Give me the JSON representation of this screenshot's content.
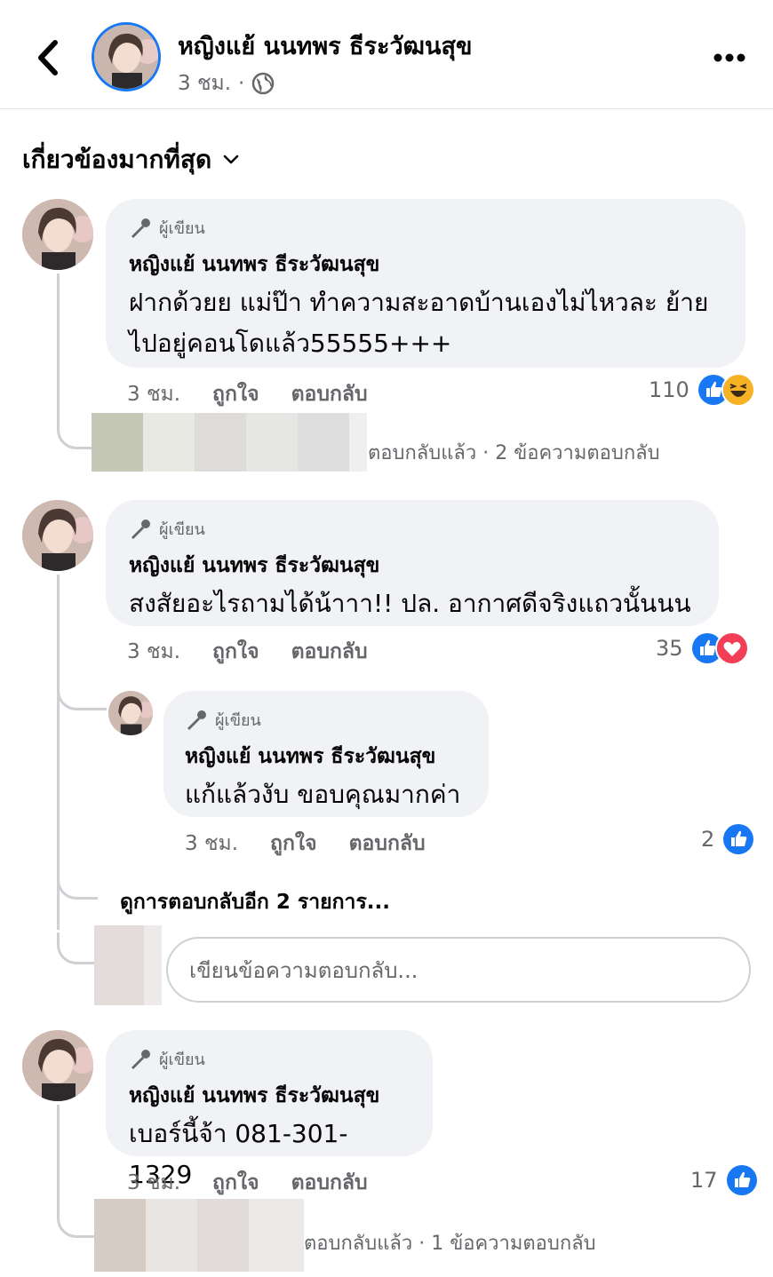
{
  "header": {
    "author_name": "หญิงแย้ นนทพร ธีระวัฒนสุข",
    "time": "3 ชม.",
    "separator": "·",
    "privacy_icon": "globe-icon"
  },
  "sort": {
    "label": "เกี่ยวข้องมากที่สุด"
  },
  "colors": {
    "like_blue": "#1877f2",
    "secondary_text": "#65676b",
    "bubble_bg": "#f0f2f5",
    "love_red": "#f33e58",
    "haha_yellow": "#f7b125"
  },
  "author_badge": "ผู้เขียน",
  "comments": [
    {
      "name": "หญิงแย้ นนทพร ธีระวัฒนสุข",
      "text_line1": "ฝากด้วยย แม่ป๊า ทำความสะอาดบ้านเองไม่ไหวละ ย้าย",
      "text_line2": "ไปอยู่คอนโดแล้ว55555+++",
      "time": "3 ชม.",
      "like": "ถูกใจ",
      "reply": "ตอบกลับ",
      "reaction_count": "110",
      "reactions": [
        "like",
        "haha"
      ],
      "reply_summary": "ตอบกลับแล้ว · 2 ข้อความตอบกลับ"
    },
    {
      "name": "หญิงแย้ นนทพร ธีระวัฒนสุข",
      "text": "สงสัยอะไรถามได้น้าาา!! ปล. อากาศดีจริงแถวนั้นนน",
      "time": "3 ชม.",
      "like": "ถูกใจ",
      "reply": "ตอบกลับ",
      "reaction_count": "35",
      "reactions": [
        "like",
        "love"
      ],
      "nested_reply": {
        "name": "หญิงแย้ นนทพร ธีระวัฒนสุข",
        "text": "แก้แล้วงับ ขอบคุณมากค่า",
        "time": "3 ชม.",
        "like": "ถูกใจ",
        "reply": "ตอบกลับ",
        "reaction_count": "2",
        "reactions": [
          "like"
        ]
      },
      "more_replies": "ดูการตอบกลับอีก 2 รายการ...",
      "reply_placeholder": "เขียนข้อความตอบกลับ..."
    },
    {
      "name": "หญิงแย้ นนทพร ธีระวัฒนสุข",
      "text": "เบอร์นี้จ้า 081-301-1329",
      "time": "3 ชม.",
      "like": "ถูกใจ",
      "reply": "ตอบกลับ",
      "reaction_count": "17",
      "reactions": [
        "like"
      ],
      "reply_summary": "ตอบกลับแล้ว · 1 ข้อความตอบกลับ"
    }
  ]
}
